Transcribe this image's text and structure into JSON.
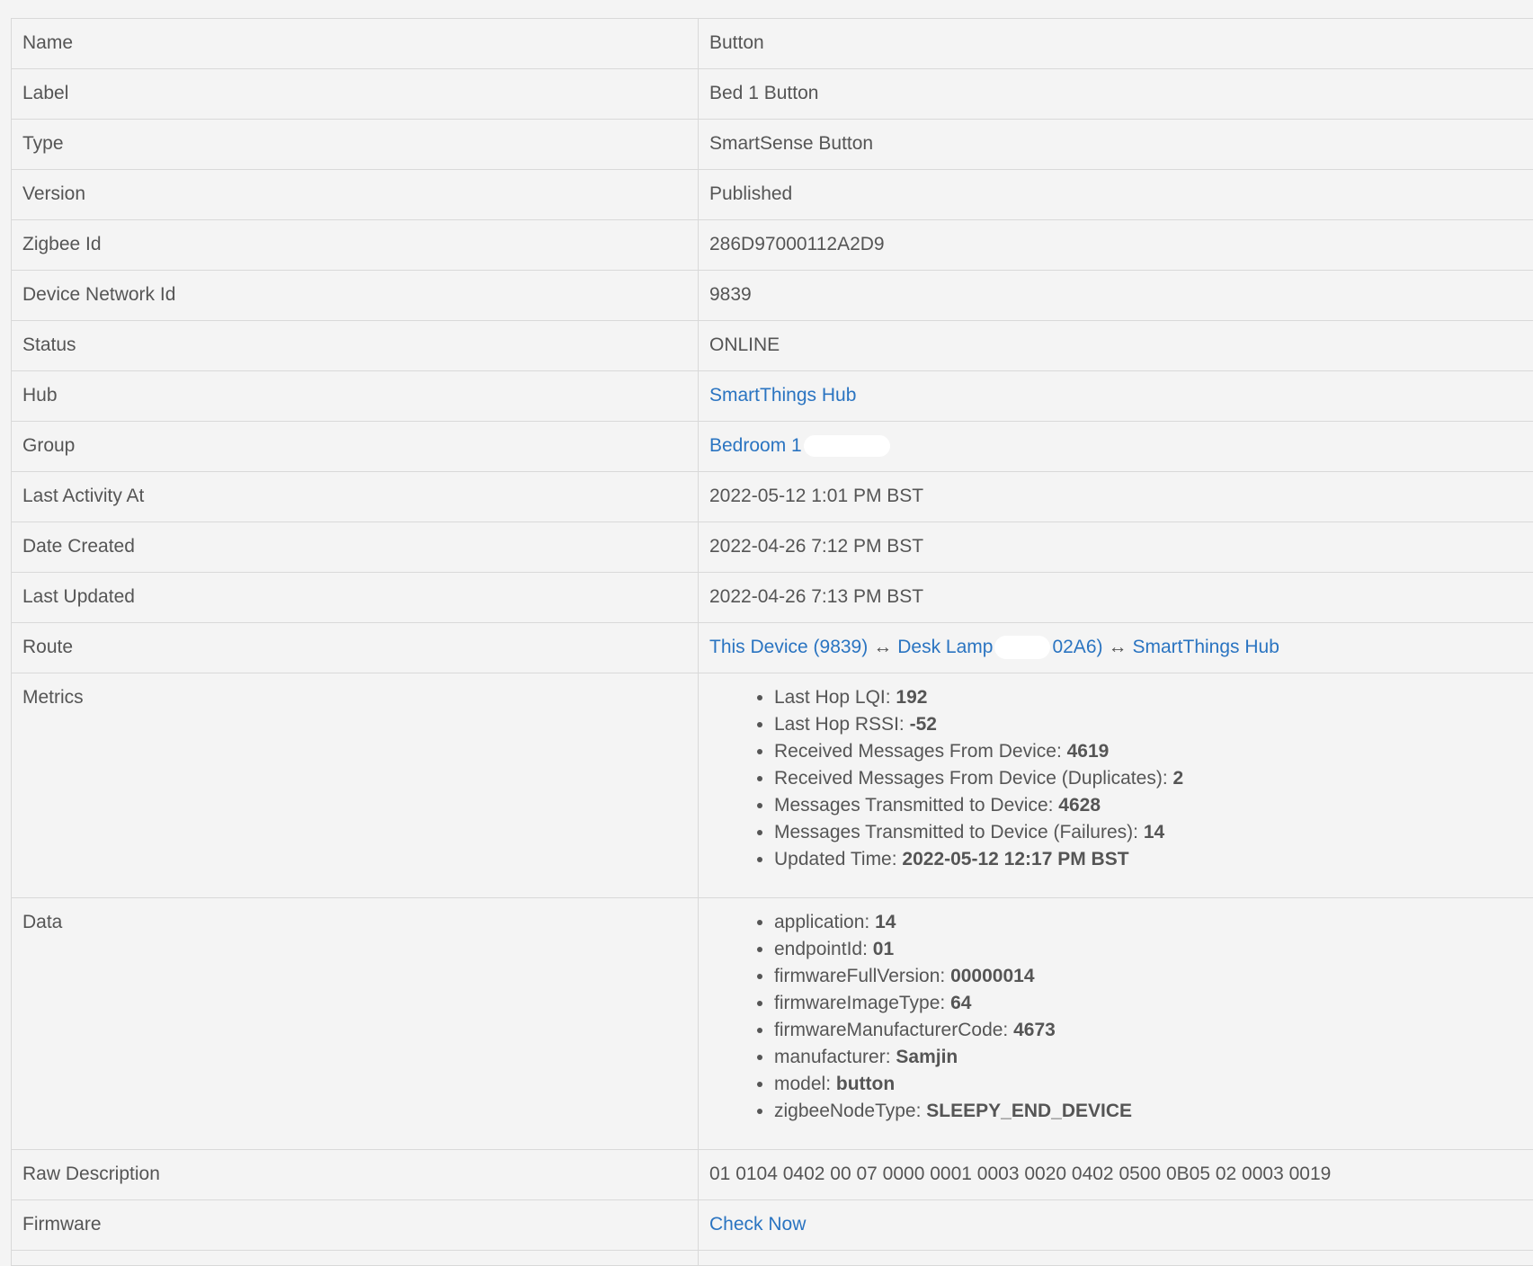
{
  "rows": {
    "name": {
      "key": "Name",
      "value": "Button"
    },
    "label": {
      "key": "Label",
      "value": "Bed 1 Button"
    },
    "type": {
      "key": "Type",
      "value": "SmartSense Button"
    },
    "version": {
      "key": "Version",
      "value": "Published"
    },
    "zigbee_id": {
      "key": "Zigbee Id",
      "value": "286D97000112A2D9"
    },
    "device_network_id": {
      "key": "Device Network Id",
      "value": "9839"
    },
    "status": {
      "key": "Status",
      "value": "ONLINE"
    },
    "hub": {
      "key": "Hub",
      "value": "SmartThings Hub"
    },
    "group": {
      "key": "Group",
      "value": "Bedroom 1"
    },
    "last_activity": {
      "key": "Last Activity At",
      "value": "2022-05-12 1:01 PM BST"
    },
    "date_created": {
      "key": "Date Created",
      "value": "2022-04-26 7:12 PM BST"
    },
    "last_updated": {
      "key": "Last Updated",
      "value": "2022-04-26 7:13 PM BST"
    },
    "route": {
      "key": "Route",
      "this_device": "This Device (9839)",
      "arrow": "↔",
      "desk_lamp_start": "Desk Lamp",
      "desk_lamp_end": "02A6)",
      "hub": "SmartThings Hub"
    },
    "metrics": {
      "key": "Metrics",
      "items": [
        {
          "label": "Last Hop LQI: ",
          "value": "192"
        },
        {
          "label": "Last Hop RSSI: ",
          "value": "-52"
        },
        {
          "label": "Received Messages From Device: ",
          "value": "4619"
        },
        {
          "label": "Received Messages From Device (Duplicates): ",
          "value": "2"
        },
        {
          "label": "Messages Transmitted to Device: ",
          "value": "4628"
        },
        {
          "label": "Messages Transmitted to Device (Failures): ",
          "value": "14"
        },
        {
          "label": "Updated Time: ",
          "value": "2022-05-12 12:17 PM BST"
        }
      ]
    },
    "data": {
      "key": "Data",
      "items": [
        {
          "label": "application: ",
          "value": "14"
        },
        {
          "label": "endpointId: ",
          "value": "01"
        },
        {
          "label": "firmwareFullVersion: ",
          "value": "00000014"
        },
        {
          "label": "firmwareImageType: ",
          "value": "64"
        },
        {
          "label": "firmwareManufacturerCode: ",
          "value": "4673"
        },
        {
          "label": "manufacturer: ",
          "value": "Samjin"
        },
        {
          "label": "model: ",
          "value": "button"
        },
        {
          "label": "zigbeeNodeType: ",
          "value": "SLEEPY_END_DEVICE"
        }
      ]
    },
    "raw_description": {
      "key": "Raw Description",
      "value": "01 0104 0402 00 07 0000 0001 0003 0020 0402 0500 0B05 02 0003 0019"
    },
    "firmware": {
      "key": "Firmware",
      "value": "Check Now"
    }
  },
  "colors": {
    "link": "#2a74c1",
    "text": "#555555",
    "background": "#f4f4f4",
    "border": "#d9d9d9"
  }
}
